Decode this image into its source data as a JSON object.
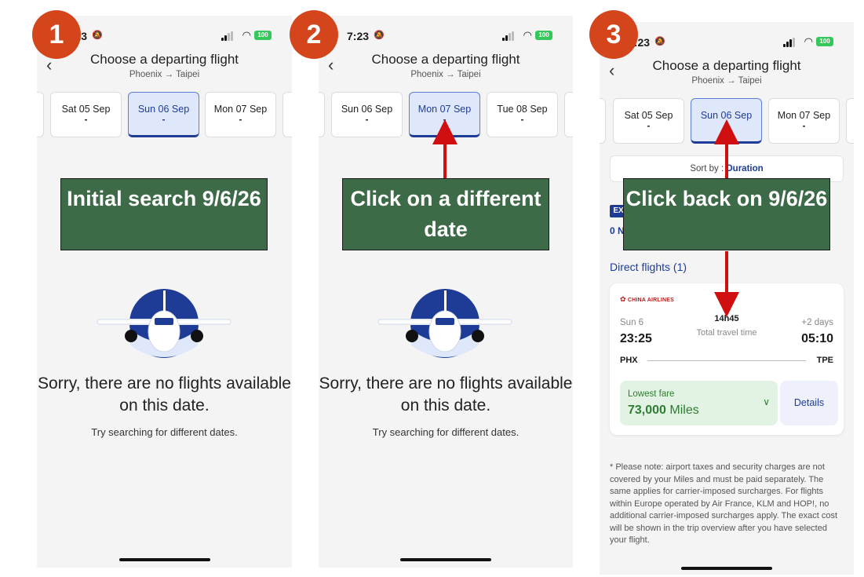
{
  "steps": [
    "1",
    "2",
    "3"
  ],
  "status": {
    "time": "7:23",
    "battery": "100"
  },
  "header": {
    "title": "Choose a departing flight",
    "subtitle": "Phoenix → Taipei"
  },
  "screen1": {
    "dates": [
      {
        "date": "Sat 05 Sep",
        "value": "-"
      },
      {
        "date": "Sun 06 Sep",
        "value": "-"
      },
      {
        "date": "Mon 07 Sep",
        "value": "-"
      }
    ],
    "message": "Sorry, there are no flights available on this date.",
    "hint": "Try searching for different dates.",
    "callout": "Initial search 9/6/26"
  },
  "screen2": {
    "dates": [
      {
        "date": "Sun 06 Sep",
        "value": "-"
      },
      {
        "date": "Mon 07 Sep",
        "value": "-"
      },
      {
        "date": "Tue 08 Sep",
        "value": "-"
      }
    ],
    "message": "Sorry, there are no flights available on this date.",
    "hint": "Try searching for different dates.",
    "callout": "Click on a different date"
  },
  "screen3": {
    "dates": [
      {
        "date": "Sat 05 Sep",
        "value": "-"
      },
      {
        "date": "Sun 06 Sep",
        "value": "-"
      },
      {
        "date": "Mon 07 Sep",
        "value": "-"
      }
    ],
    "sort_label": "Sort by :",
    "sort_value": "Duration",
    "ex_badge": "EX",
    "ex_row": "0 N",
    "section": "Direct flights (1)",
    "callout": "Click back on 9/6/26",
    "flight": {
      "airline": "CHINA AIRLINES",
      "departure_day": "Sun 6",
      "departure_time": "23:25",
      "duration": "14h45",
      "duration_label": "Total travel time",
      "arrival_day": "+2 days",
      "arrival_time": "05:10",
      "from": "PHX",
      "to": "TPE",
      "fare_label": "Lowest fare",
      "fare_value": "73,000",
      "fare_unit": "Miles",
      "details_label": "Details"
    },
    "note": "* Please note: airport taxes and security charges are not covered by your Miles and must be paid separately. The same applies for carrier-imposed surcharges. For flights within Europe operated by Air France, KLM and HOP!, no additional carrier-imposed surcharges apply. The exact cost will be shown in the trip overview after you have selected your flight."
  },
  "colors": {
    "brand_blue": "#1e3c96",
    "callout_green": "#3d6b47",
    "step_orange": "#d4451c",
    "arrow_red": "#d01010",
    "fare_green": "#2e7d32"
  },
  "icons": [
    "back-chevron-icon",
    "bell-slash-icon",
    "signal-icon",
    "wifi-icon",
    "battery-icon",
    "plane-icon",
    "chevron-down-icon",
    "china-airlines-logo-icon"
  ]
}
